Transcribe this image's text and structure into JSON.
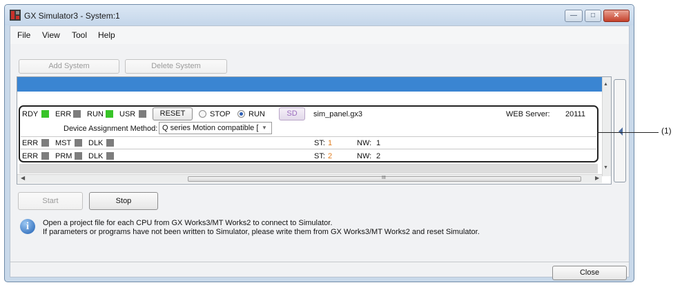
{
  "window": {
    "title": "GX Simulator3 - System:1"
  },
  "menu": [
    "File",
    "View",
    "Tool",
    "Help"
  ],
  "toolbar": {
    "add_system": "Add System",
    "delete_system": "Delete System"
  },
  "system": {
    "status1": {
      "rdy": "RDY",
      "err": "ERR",
      "run": "RUN",
      "usr": "USR"
    },
    "reset_label": "RESET",
    "stop_label": "STOP",
    "run_label": "RUN",
    "run_selected": "RUN",
    "sd_label": "SD",
    "project_file": "sim_panel.gx3",
    "web_server_label": "WEB Server:",
    "web_server_port": "20111",
    "device_assignment_label": "Device Assignment Method:",
    "device_assignment_value": "Q series Motion compatible [",
    "network_rows": [
      {
        "l1": "ERR",
        "l2": "MST",
        "l3": "DLK",
        "st_label": "ST:",
        "st": "1",
        "nw_label": "NW:",
        "nw": "1"
      },
      {
        "l1": "ERR",
        "l2": "PRM",
        "l3": "DLK",
        "st_label": "ST:",
        "st": "2",
        "nw_label": "NW:",
        "nw": "2"
      }
    ]
  },
  "scrollbar": {
    "h_grip": "III"
  },
  "controls": {
    "start": "Start",
    "stop": "Stop"
  },
  "info": {
    "line1": "Open a project file for each CPU from GX Works3/MT Works2 to connect to Simulator.",
    "line2": "If parameters or programs have not been written to Simulator, please write them from GX Works3/MT Works2 and reset Simulator."
  },
  "footer": {
    "close": "Close"
  },
  "callout": {
    "label": "(1)"
  },
  "colors": {
    "selection": "#3a85d2",
    "led_on": "#38c428",
    "led_off": "#7d7d7d",
    "st_value": "#e07b1a"
  }
}
